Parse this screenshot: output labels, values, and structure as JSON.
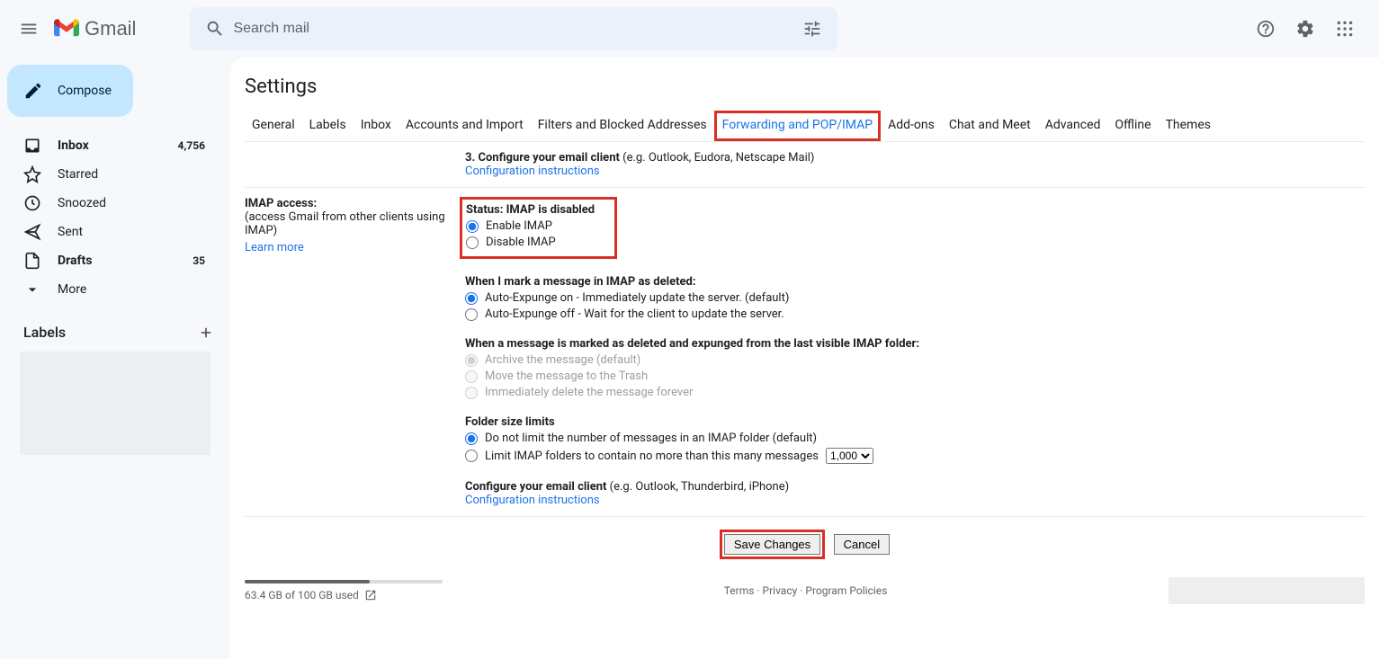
{
  "header": {
    "logo_text": "Gmail",
    "search_placeholder": "Search mail"
  },
  "compose_label": "Compose",
  "nav": {
    "inbox": {
      "label": "Inbox",
      "count": "4,756"
    },
    "starred": {
      "label": "Starred"
    },
    "snoozed": {
      "label": "Snoozed"
    },
    "sent": {
      "label": "Sent"
    },
    "drafts": {
      "label": "Drafts",
      "count": "35"
    },
    "more": {
      "label": "More"
    }
  },
  "labels_header": "Labels",
  "settings_title": "Settings",
  "tabs": {
    "general": "General",
    "labels": "Labels",
    "inbox": "Inbox",
    "accounts": "Accounts and Import",
    "filters": "Filters and Blocked Addresses",
    "forwarding": "Forwarding and POP/IMAP",
    "addons": "Add-ons",
    "chat": "Chat and Meet",
    "advanced": "Advanced",
    "offline": "Offline",
    "themes": "Themes"
  },
  "pop_remnant": {
    "step3_bold": "3. Configure your email client",
    "step3_rest": " (e.g. Outlook, Eudora, Netscape Mail)",
    "config_link": "Configuration instructions"
  },
  "imap": {
    "left_title": "IMAP access:",
    "left_desc": "(access Gmail from other clients using IMAP)",
    "learn_more": "Learn more",
    "status_label": "Status: IMAP is disabled",
    "enable_label": "Enable IMAP",
    "disable_label": "Disable IMAP",
    "expunge_title": "When I mark a message in IMAP as deleted:",
    "expunge_on": "Auto-Expunge on - Immediately update the server. (default)",
    "expunge_off": "Auto-Expunge off - Wait for the client to update the server.",
    "deleted_title": "When a message is marked as deleted and expunged from the last visible IMAP folder:",
    "deleted_archive": "Archive the message (default)",
    "deleted_trash": "Move the message to the Trash",
    "deleted_delete": "Immediately delete the message forever",
    "folder_title": "Folder size limits",
    "folder_nolimit": "Do not limit the number of messages in an IMAP folder (default)",
    "folder_limit": "Limit IMAP folders to contain no more than this many messages",
    "folder_select": "1,000",
    "config_bold": "Configure your email client",
    "config_rest": " (e.g. Outlook, Thunderbird, iPhone)",
    "config_link": "Configuration instructions"
  },
  "buttons": {
    "save": "Save Changes",
    "cancel": "Cancel"
  },
  "footer": {
    "storage": "63.4 GB of 100 GB used",
    "terms": "Terms",
    "privacy": "Privacy",
    "policies": "Program Policies"
  }
}
